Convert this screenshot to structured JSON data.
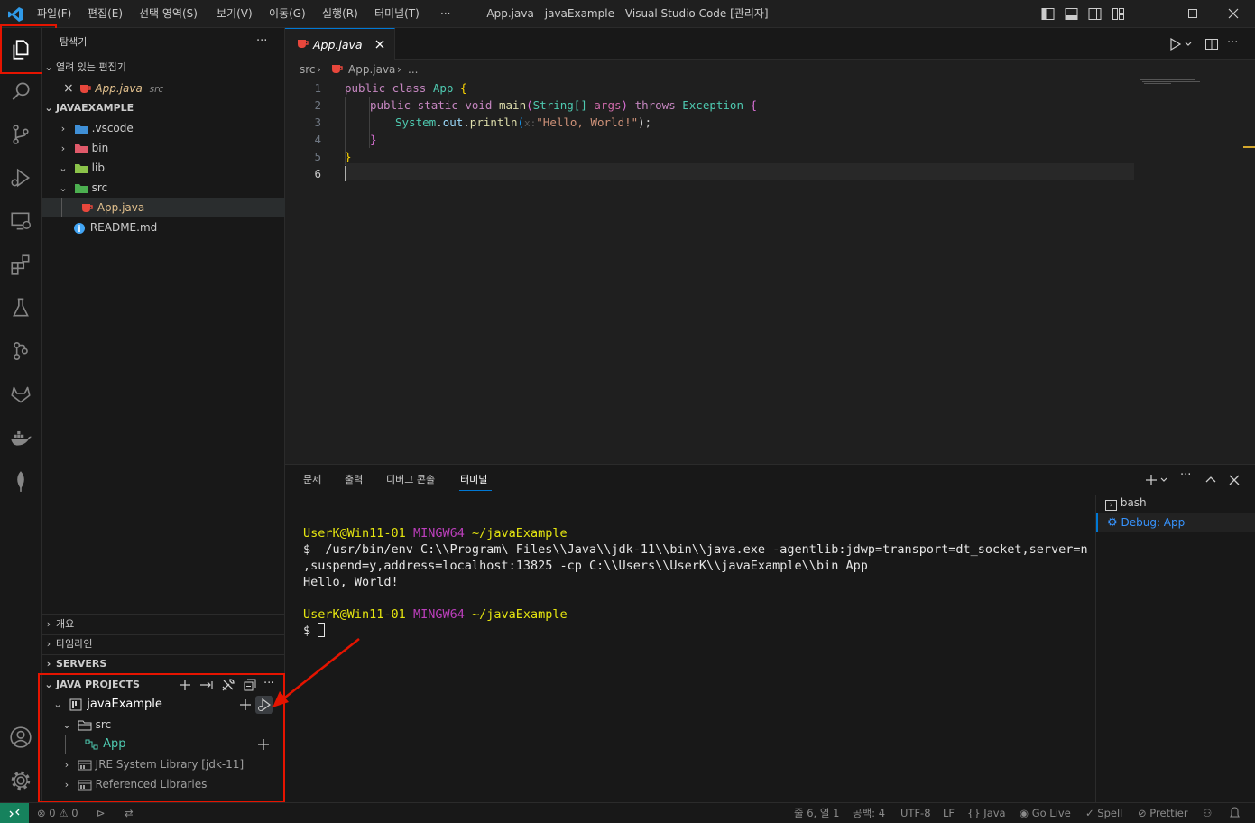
{
  "titlebar": {
    "menus": [
      "파일(F)",
      "편집(E)",
      "선택 영역(S)",
      "보기(V)",
      "이동(G)",
      "실행(R)",
      "터미널(T)",
      "···"
    ],
    "window_title": "App.java - javaExample - Visual Studio Code [관리자]"
  },
  "activity_bar": {
    "items": [
      "explorer-icon",
      "search-icon",
      "source-control-icon",
      "run-debug-icon",
      "remote-explorer-icon",
      "extensions-icon",
      "testing-icon",
      "gitlens-icon",
      "gitlab-icon",
      "docker-icon",
      "mongodb-icon"
    ],
    "bottom": [
      "accounts-icon",
      "manage-gear-icon"
    ]
  },
  "sidebar": {
    "title": "탐색기",
    "more": "···",
    "open_editors_label": "열려 있는 편집기",
    "open_editor_file": "App.java",
    "open_editor_folder": "src",
    "workspace_label": "JAVAEXAMPLE",
    "tree": [
      {
        "name": ".vscode",
        "kind": "folder"
      },
      {
        "name": "bin",
        "kind": "folder"
      },
      {
        "name": "lib",
        "kind": "folder"
      },
      {
        "name": "src",
        "kind": "folder"
      },
      {
        "name": "App.java",
        "kind": "file"
      },
      {
        "name": "README.md",
        "kind": "file"
      }
    ],
    "collapsed_sections": [
      "개요",
      "타임라인",
      "SERVERS"
    ],
    "java_projects": {
      "label": "JAVA PROJECTS",
      "project": "javaExample",
      "src": "src",
      "class": "App",
      "jre": "JRE System Library [jdk-11]",
      "ref_libs": "Referenced Libraries"
    }
  },
  "editor": {
    "tab_label": "App.java",
    "breadcrumb": {
      "folder": "src",
      "file": "App.java",
      "tail": "..."
    },
    "line_numbers": [
      "1",
      "2",
      "3",
      "4",
      "5",
      "6"
    ],
    "code": {
      "l1_kw": "public class",
      "l1_name": "App",
      "l1_brace": "{",
      "l2_kw1": "public static void",
      "l2_fn": "main",
      "l2_paren_open": "(",
      "l2_type": "String[]",
      "l2_param": "args",
      "l2_paren_close": ")",
      "l2_throws": "throws",
      "l2_exc": "Exception",
      "l2_brace": "{",
      "l3_sys": "System",
      "l3_dot1": ".",
      "l3_out": "out",
      "l3_dot2": ".",
      "l3_fn": "println",
      "l3_po": "(",
      "l3_hint": "x:",
      "l3_str": "\"Hello, World!\"",
      "l3_end": ");",
      "l4": "}",
      "l5": "}"
    }
  },
  "panel": {
    "tabs": [
      "문제",
      "출력",
      "디버그 콘솔",
      "터미널"
    ],
    "active_tab": "터미널",
    "terminals": [
      "bash",
      "Debug: App"
    ],
    "terminal_lines": {
      "p1_user": "UserK@Win11-01",
      "p1_env": "MINGW64",
      "p1_path": "~/javaExample",
      "cmd1": "$  /usr/bin/env C:\\\\Program\\ Files\\\\Java\\\\jdk-11\\\\bin\\\\java.exe -agentlib:jdwp=transport=dt_socket,server=n",
      "cmd2": ",suspend=y,address=localhost:13825 -cp C:\\\\Users\\\\UserK\\\\javaExample\\\\bin App",
      "out": "Hello, World!",
      "p2_user": "UserK@Win11-01",
      "p2_env": "MINGW64",
      "p2_path": "~/javaExample",
      "prompt": "$"
    }
  },
  "statusbar": {
    "errors": "0",
    "warnings": "0",
    "position": "줄 6, 열 1",
    "spaces": "공백: 4",
    "encoding": "UTF-8",
    "eol": "LF",
    "language": "Java",
    "golive": "Go Live",
    "spell": "Spell",
    "prettier": "Prettier"
  },
  "colors": {
    "accent": "#0078d4",
    "highlight_box": "#e51400",
    "keyword": "#c586c0",
    "storage": "#569cd6",
    "string": "#ce9178",
    "function": "#dcdcaa",
    "class": "#4ec9b0",
    "param": "#9cdcfe",
    "java_icon": "#e8473c",
    "term_yellow": "#e5e510",
    "term_magenta": "#bc3fbc"
  }
}
